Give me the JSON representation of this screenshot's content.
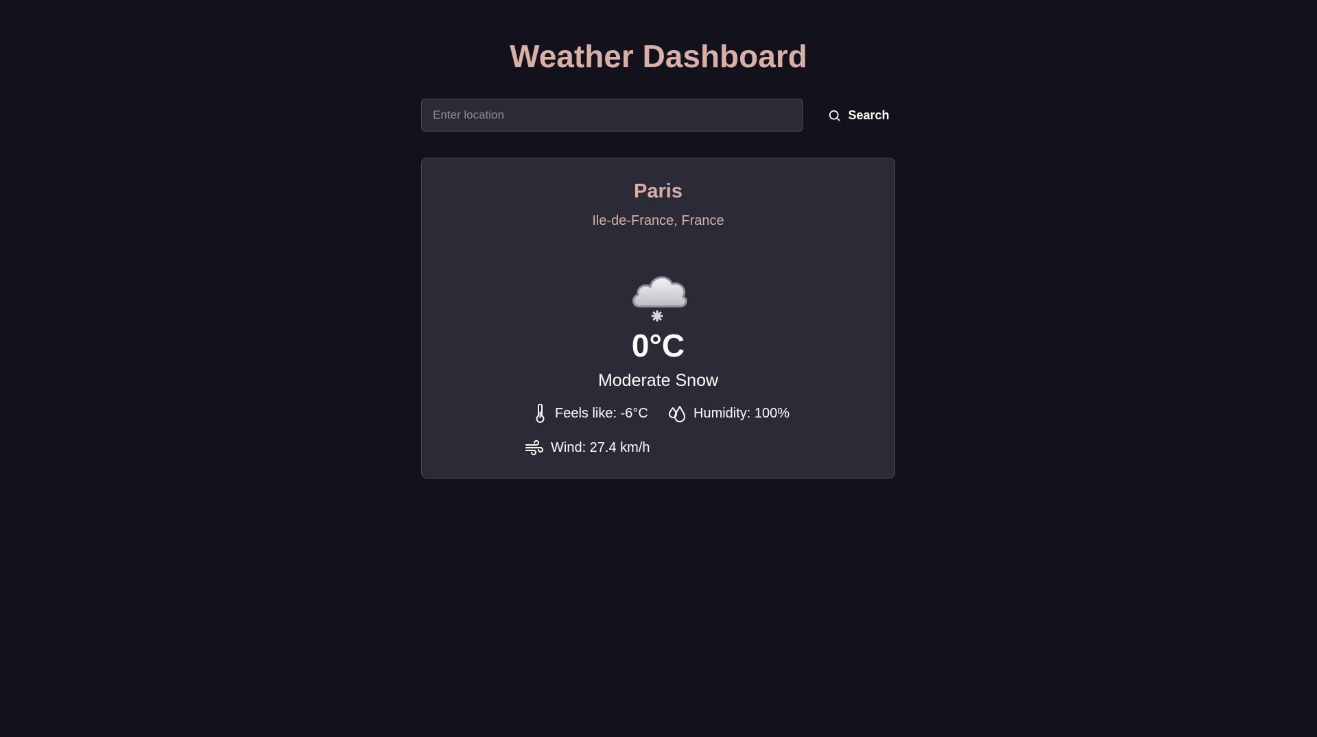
{
  "header": {
    "title": "Weather Dashboard"
  },
  "search": {
    "placeholder": "Enter location",
    "value": "",
    "button_label": "Search",
    "button_icon": "search-icon"
  },
  "weather": {
    "city": "Paris",
    "region": "Ile-de-France, France",
    "condition_icon": "cloud-snow-icon",
    "temperature": "0°C",
    "condition": "Moderate Snow",
    "feels_like": "Feels like: -6°C",
    "humidity": "Humidity: 100%",
    "wind": "Wind: 27.4 km/h"
  },
  "colors": {
    "background": "#13121c",
    "card": "#2b2a36",
    "accent": "#d9b0a6",
    "text": "#ffffff"
  }
}
